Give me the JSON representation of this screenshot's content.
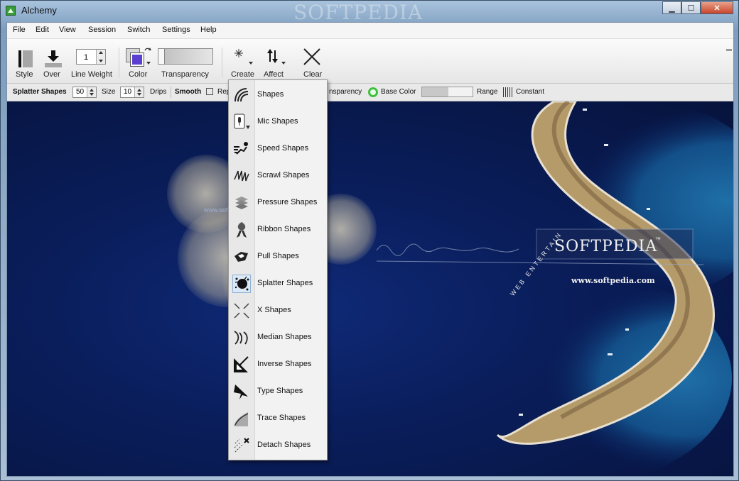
{
  "window": {
    "title": "Alchemy",
    "watermark": "SOFTPEDIA",
    "btn_min": "▁",
    "btn_max": "☐",
    "btn_close": "✕"
  },
  "menu": {
    "items": [
      "File",
      "Edit",
      "View",
      "Session",
      "Switch",
      "Settings",
      "Help"
    ]
  },
  "toolbar": {
    "style_label": "Style",
    "over_label": "Over",
    "line_weight_label": "Line Weight",
    "line_weight_value": "1",
    "color_label": "Color",
    "transparency_label": "Transparency",
    "create_label": "Create",
    "affect_label": "Affect",
    "clear_label": "Clear",
    "color_primary": "#5b3fd0",
    "color_secondary": "#d8d8d8"
  },
  "options": {
    "module": "Splatter Shapes",
    "splatter_value": "50",
    "size_label": "Size",
    "size_value": "10",
    "drips_label": "Drips",
    "smooth_label": "Smooth",
    "rep_label": "Rep",
    "transparency_label": "nsparency",
    "base_color_label": "Base Color",
    "range_label": "Range",
    "constant_label": "Constant"
  },
  "canvas": {
    "logo": "SOFTPEDIA",
    "logo_tm": "™",
    "url": "www.softpedia.com",
    "tiny_url": "www.softpedia.com",
    "arc_text": "WEB ENTERTAIN"
  },
  "create_menu": {
    "items": [
      {
        "label": "Shapes",
        "icon": "shapes-icon"
      },
      {
        "label": "Mic Shapes",
        "icon": "mic-icon"
      },
      {
        "label": "Speed Shapes",
        "icon": "speed-icon"
      },
      {
        "label": "Scrawl Shapes",
        "icon": "scrawl-icon"
      },
      {
        "label": "Pressure Shapes",
        "icon": "pressure-icon"
      },
      {
        "label": "Ribbon Shapes",
        "icon": "ribbon-icon"
      },
      {
        "label": "Pull Shapes",
        "icon": "pull-icon"
      },
      {
        "label": "Splatter Shapes",
        "icon": "splatter-icon"
      },
      {
        "label": "X Shapes",
        "icon": "x-shapes-icon"
      },
      {
        "label": "Median Shapes",
        "icon": "median-icon"
      },
      {
        "label": "Inverse Shapes",
        "icon": "inverse-icon"
      },
      {
        "label": "Type Shapes",
        "icon": "type-icon"
      },
      {
        "label": "Trace Shapes",
        "icon": "trace-icon"
      },
      {
        "label": "Detach Shapes",
        "icon": "detach-icon"
      }
    ],
    "selected": "Splatter Shapes"
  }
}
